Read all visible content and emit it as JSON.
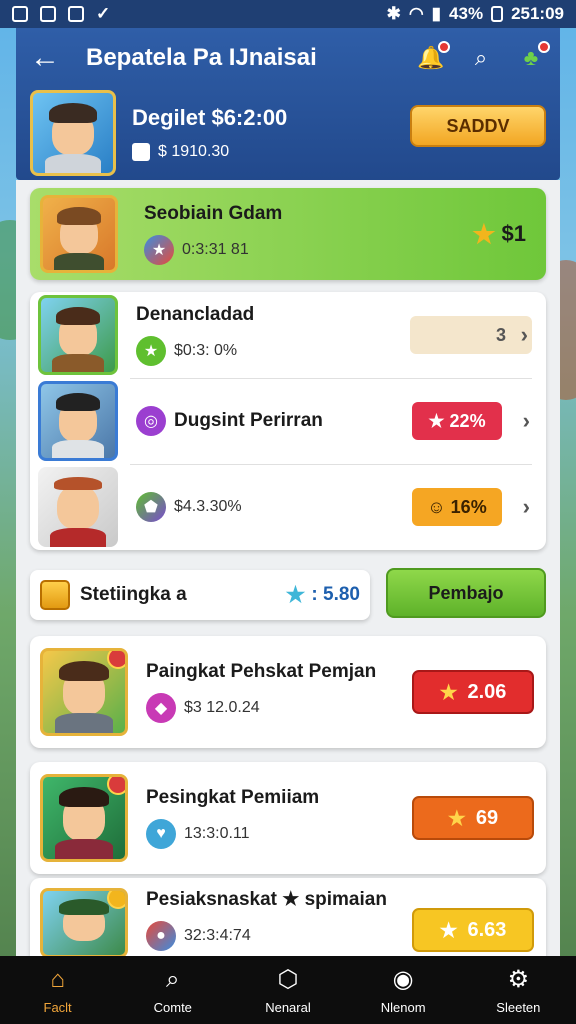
{
  "status_bar": {
    "battery": "43%",
    "time": "251:09"
  },
  "header": {
    "title": "Bepatela Pa IJnaisai",
    "balance": "Degilet $6:2:00",
    "subline": "$ 1910.30",
    "action_label": "SADDV"
  },
  "featured": {
    "title": "Seobiain Gdam",
    "sub": "0:3:31 81",
    "value": "$1"
  },
  "group_rows": [
    {
      "title": "Denancladad",
      "sub": "$0:3: 0%",
      "badge": "3",
      "badge_color": "#f4e6cc"
    },
    {
      "title": "Dugsint Perirran",
      "sub": "",
      "badge": "★ 22%",
      "badge_color": "#e2304b"
    },
    {
      "title": "",
      "sub": "$4.3.30%",
      "badge": "☺ 16%",
      "badge_color": "#f5a623"
    }
  ],
  "streak": {
    "label": "Stetiingka a",
    "value": ": 5.80",
    "button_label": "Pembajo"
  },
  "rank_cards": [
    {
      "title": "Paingkat Pehskat Pemjan",
      "sub": "$3 12.0.24",
      "button": "2.06",
      "color": "#e22d2d"
    },
    {
      "title": "Pesingkat Pemiiam",
      "sub": "13:3:0.11",
      "button": "69",
      "color": "#ec6a1c"
    },
    {
      "title": "Pesiaksnaskat ★ spimaian",
      "sub": "32:3:4:74",
      "button": "6.63",
      "color": "#f7c623"
    }
  ],
  "bottom_nav": [
    {
      "label": "Faclt",
      "icon": "home-icon"
    },
    {
      "label": "Comte",
      "icon": "search-icon"
    },
    {
      "label": "Nenaral",
      "icon": "box-icon"
    },
    {
      "label": "Nlenom",
      "icon": "store-icon"
    },
    {
      "label": "Sleeten",
      "icon": "gear-icon"
    }
  ],
  "colors": {
    "header": "#2f5ea8",
    "accent_green": "#6fc73a",
    "active_nav": "#f0a53a"
  }
}
